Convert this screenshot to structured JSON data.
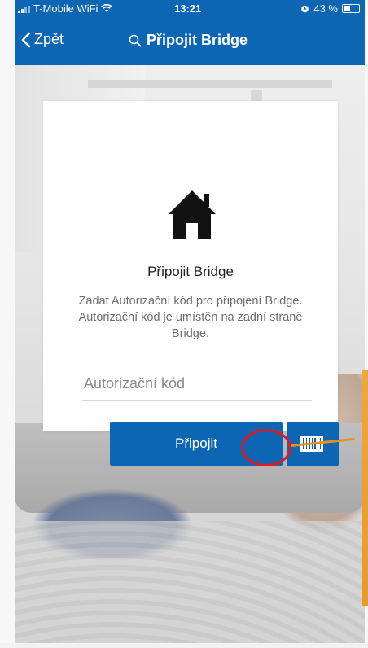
{
  "status_bar": {
    "carrier": "T-Mobile WiFi",
    "time": "13:21",
    "battery": "43 %",
    "icons": [
      "signal-icon",
      "wifi-icon",
      "alarm-icon",
      "battery-icon"
    ]
  },
  "nav": {
    "back_label": "Zpět",
    "title": "Připojit Bridge",
    "icons": [
      "chevron-left-icon",
      "search-icon"
    ]
  },
  "dialog": {
    "icon": "house-icon",
    "title": "Připojit Bridge",
    "description": "Zadat Autorizační kód pro připojení Bridge. Autorizační kód je umístěn na zadní straně Bridge.",
    "input_placeholder": "Autorizační kód",
    "input_value": "",
    "connect_label": "Připojit",
    "scan_icon": "barcode-icon"
  },
  "colors": {
    "brand_blue": "#0d66b3",
    "highlight_red": "#e0191f",
    "pointer_orange": "#e8901e"
  }
}
